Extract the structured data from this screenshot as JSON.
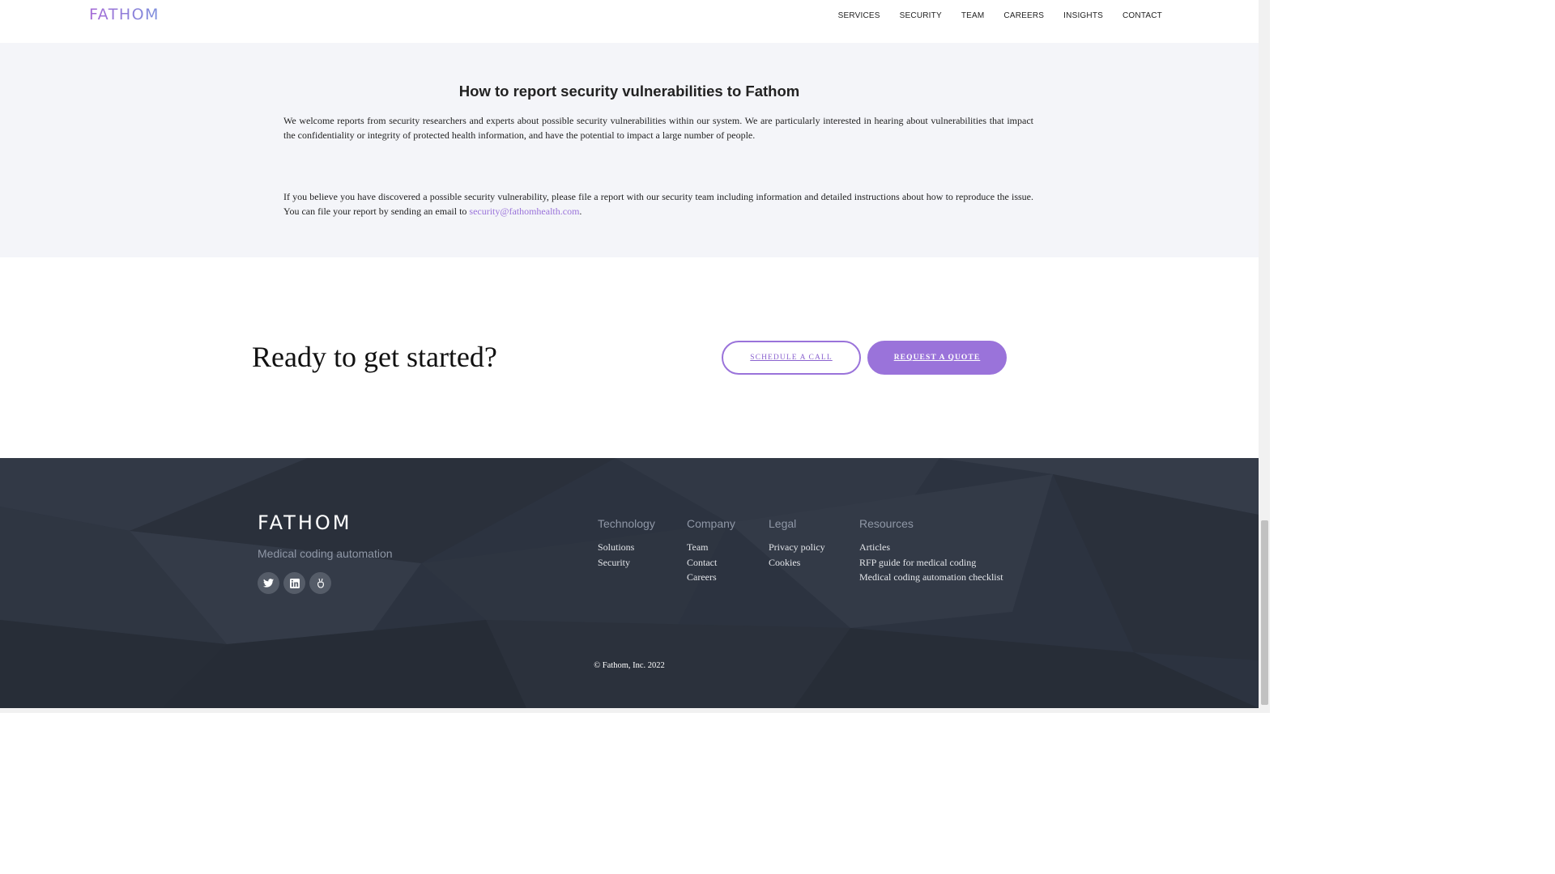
{
  "header": {
    "logo": "FATHOM",
    "nav": [
      "SERVICES",
      "SECURITY",
      "TEAM",
      "CAREERS",
      "INSIGHTS",
      "CONTACT"
    ]
  },
  "vuln": {
    "title": "How to report security vulnerabilities to Fathom",
    "para1": "We welcome reports from security researchers and experts about possible security vulnerabilities within our system. We are particularly interested in hearing about vulnerabilities that impact the confidentiality or integrity of protected health information, and have the potential to impact a large number of people.",
    "para2_before": "If you believe you have discovered a possible security vulnerability, please file a report with our security team including information and detailed instructions about how to reproduce the issue. You can file your report by sending an email to ",
    "email": "security@fathomhealth.com",
    "para2_after": "."
  },
  "cta": {
    "title": "Ready to get started?",
    "schedule_label": "SCHEDULE A CALL",
    "quote_label": "REQUEST A QUOTE"
  },
  "footer": {
    "logo": "FATHOM",
    "tagline": "Medical coding automation",
    "social": [
      "twitter-icon",
      "linkedin-icon",
      "angellist-icon"
    ],
    "columns": [
      {
        "title": "Technology",
        "links": [
          "Solutions",
          "Security"
        ]
      },
      {
        "title": "Company",
        "links": [
          "Team",
          "Contact",
          "Careers"
        ]
      },
      {
        "title": "Legal",
        "links": [
          "Privacy policy",
          "Cookies"
        ]
      },
      {
        "title": "Resources",
        "links": [
          "Articles",
          "RFP guide for medical coding",
          "Medical coding automation checklist"
        ]
      }
    ],
    "copyright": "© Fathom, Inc. 2022"
  },
  "colors": {
    "accent": "#9a73da",
    "footer_bg": "#2c3340",
    "section_bg": "#f4f5f9"
  }
}
